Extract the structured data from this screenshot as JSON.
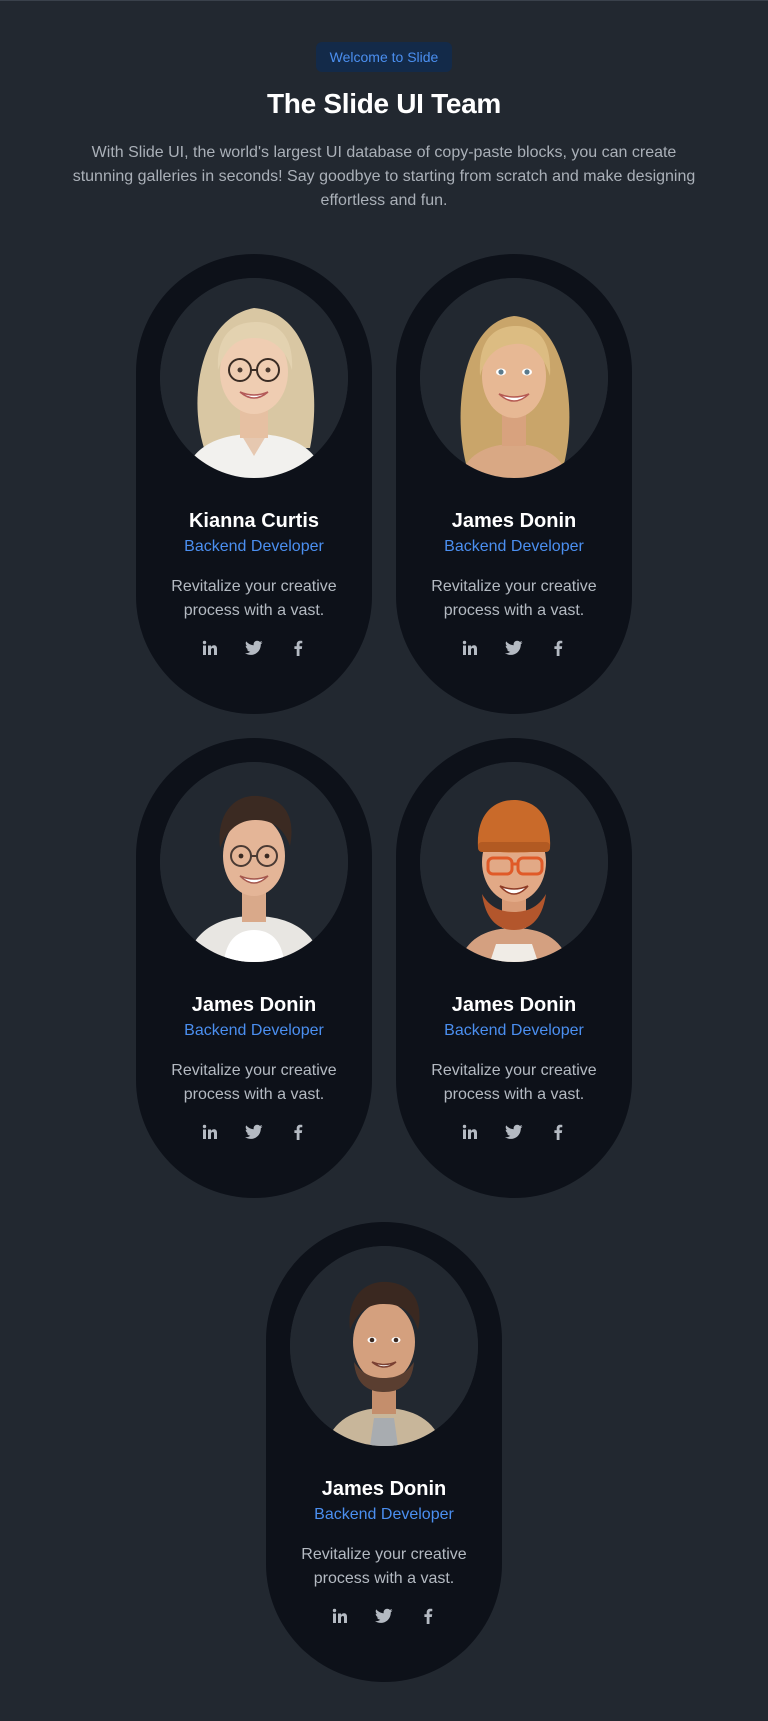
{
  "header": {
    "badge": "Welcome to Slide",
    "title": "The Slide UI Team",
    "subtitle": "With Slide UI, the world's largest UI database of copy-paste blocks, you can create stunning galleries in seconds! Say goodbye to starting from scratch and make designing effortless and fun."
  },
  "members": [
    {
      "name": "Kianna Curtis",
      "role": "Backend Developer",
      "bio": "Revitalize your creative process with a vast."
    },
    {
      "name": "James Donin",
      "role": "Backend Developer",
      "bio": "Revitalize your creative process with a vast."
    },
    {
      "name": "James Donin",
      "role": "Backend Developer",
      "bio": "Revitalize your creative process with a vast."
    },
    {
      "name": "James Donin",
      "role": "Backend Developer",
      "bio": "Revitalize your creative process with a vast."
    },
    {
      "name": "James Donin",
      "role": "Backend Developer",
      "bio": "Revitalize your creative process with a vast."
    }
  ],
  "social_icons": [
    "linkedin-icon",
    "twitter-icon",
    "facebook-icon"
  ],
  "colors": {
    "background": "#222830",
    "card": "#0d1119",
    "accent": "#4b8ff0",
    "badge_bg": "#132a49",
    "muted_text": "#b4bac2"
  }
}
